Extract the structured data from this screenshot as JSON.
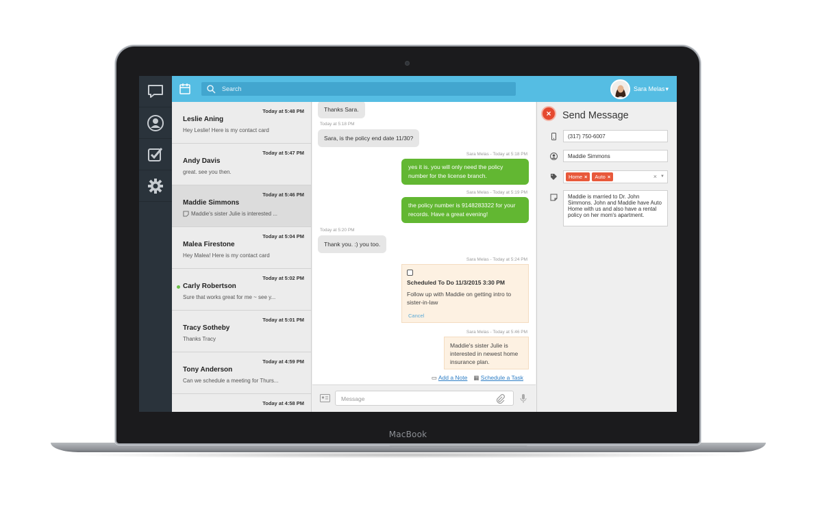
{
  "device": {
    "brand": "MacBook"
  },
  "topbar": {
    "search_placeholder": "Search",
    "user_name": "Sara Melas"
  },
  "conversations": [
    {
      "time": "Today at 5:48 PM",
      "name": "Leslie Aning",
      "preview": "Hey Leslie! Here is my contact card",
      "active": false,
      "online": false
    },
    {
      "time": "Today at 5:47 PM",
      "name": "Andy Davis",
      "preview": "great. see you then.",
      "active": false,
      "online": false
    },
    {
      "time": "Today at 5:46 PM",
      "name": "Maddie Simmons",
      "preview": "Maddie's sister Julie is interested ...",
      "active": true,
      "online": false
    },
    {
      "time": "Today at 5:04 PM",
      "name": "Malea Firestone",
      "preview": "Hey Malea! Here is my contact card",
      "active": false,
      "online": false
    },
    {
      "time": "Today at 5:02 PM",
      "name": "Carly Robertson",
      "preview": "Sure that works great for me ~ see y...",
      "active": false,
      "online": true
    },
    {
      "time": "Today at 5:01 PM",
      "name": "Tracy Sotheby",
      "preview": "Thanks Tracy",
      "active": false,
      "online": false
    },
    {
      "time": "Today at 4:59 PM",
      "name": "Tony Anderson",
      "preview": "Can we schedule a meeting for Thurs...",
      "active": false,
      "online": false
    },
    {
      "time": "Today at 4:58 PM",
      "name": "",
      "preview": "",
      "active": false,
      "online": false
    }
  ],
  "chat": {
    "m1": "Thanks Sara.",
    "t2": "Today at 5:18 PM",
    "m2": "Sara, is the policy end date 11/30?",
    "t3": "Sara Melas - Today at 5:18 PM",
    "m3": "yes it is. you will only need the policy number for the license branch.",
    "t4": "Sara Melas - Today at 5:19 PM",
    "m4": "the policy number is 9148283322 for your records. Have a great evening!",
    "t5": "Today at 5:20 PM",
    "m5": "Thank you. :) you too.",
    "t6": "Sara Melas - Today at 5:24 PM",
    "task_title": "Scheduled To Do 11/3/2015 3:30 PM",
    "task_body": "Follow up with Maddie on getting intro to sister-in-law",
    "task_cancel": "Cancel",
    "t7": "Sara Melas - Today at 5:46 PM",
    "note": "Maddie's sister Julie is interested in newest home insurance plan.",
    "add_note": "Add a Note",
    "schedule_task": "Schedule a Task",
    "composer_placeholder": "Message"
  },
  "panel": {
    "title": "Send Message",
    "phone": "(317) 750-6007",
    "name": "Maddie Simmons",
    "tags": [
      "Home",
      "Auto"
    ],
    "notes": "Maddie is married to Dr. John Simmons. John and Maddie have Auto Home with us and also have a rental policy on her mom's apartment."
  },
  "colors": {
    "accent": "#55bde3",
    "sent_bubble": "#62b732",
    "tag": "#e8593b",
    "rail": "#2a333b"
  }
}
